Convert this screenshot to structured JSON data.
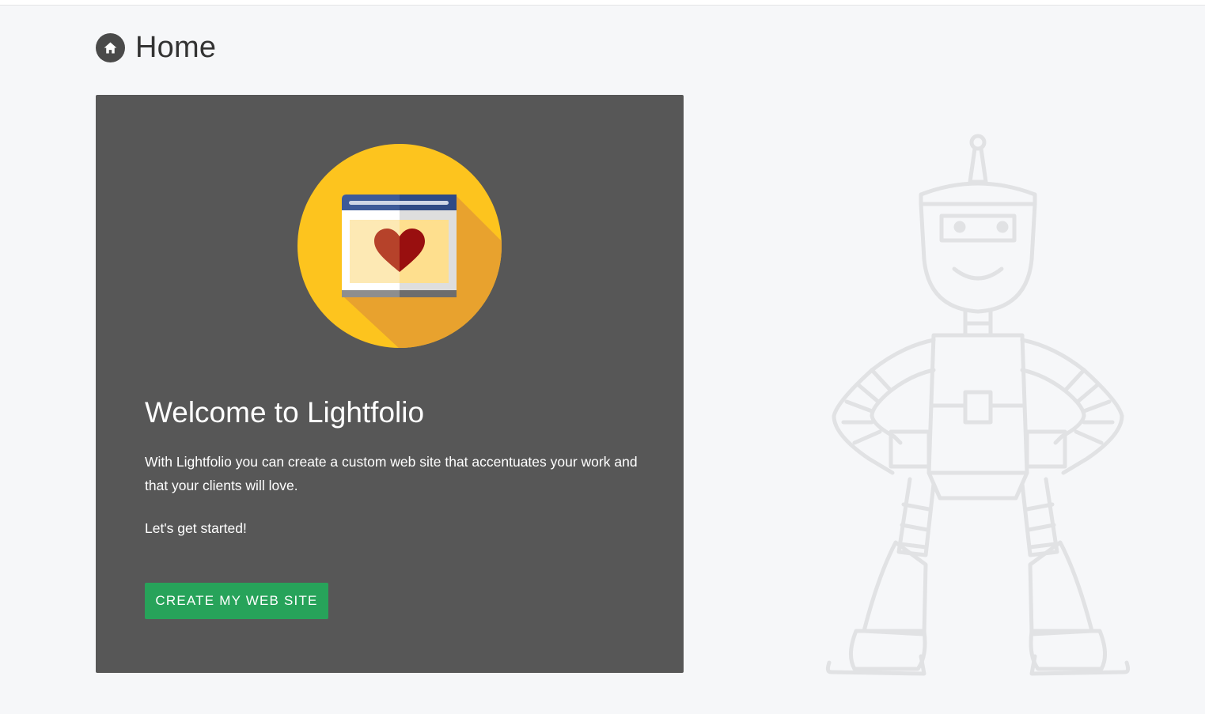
{
  "page": {
    "title": "Home",
    "icon": "home-icon"
  },
  "welcome": {
    "title": "Welcome to Lightfolio",
    "description": "With Lightfolio you can create a custom web site that accentuates your work and that your clients will love.",
    "cta_text": "Let's get started!",
    "button_label": "CREATE MY WEB SITE",
    "illustration_icon": "browser-heart-icon"
  },
  "decoration": {
    "mascot_icon": "robot-mascot-icon"
  },
  "colors": {
    "background": "#f6f7f9",
    "card": "#575757",
    "button": "#27a35a",
    "accent_yellow": "#fdc41e"
  }
}
